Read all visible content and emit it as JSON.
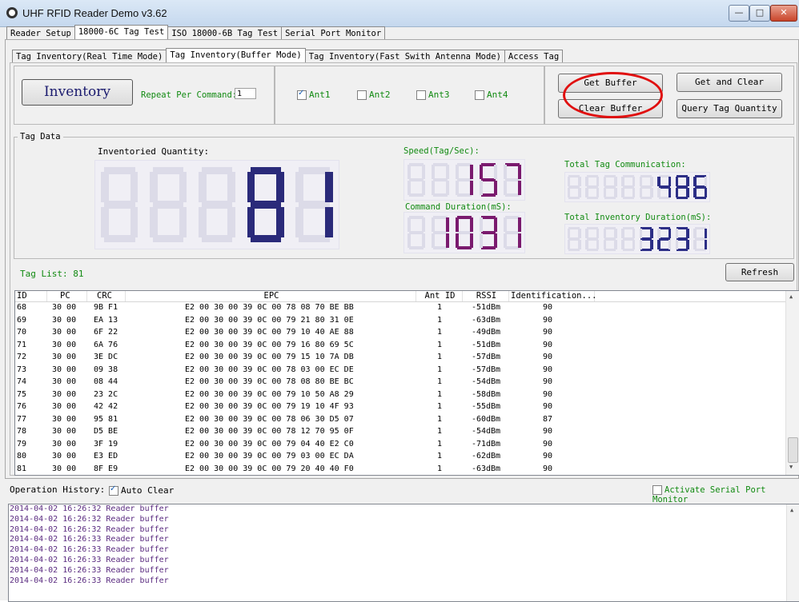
{
  "window": {
    "title": "UHF RFID Reader Demo v3.62",
    "min": "—",
    "max": "□",
    "close": "✕"
  },
  "main_tabs": [
    "Reader Setup",
    "18000-6C Tag Test",
    "ISO 18000-6B Tag Test",
    "Serial Port Monitor"
  ],
  "sub_tabs": [
    "Tag Inventory(Real Time Mode)",
    "Tag Inventory(Buffer Mode)",
    "Tag Inventory(Fast Swith Antenna Mode)",
    "Access Tag"
  ],
  "controls": {
    "inventory_label": "Inventory",
    "repeat_label": "Repeat Per Command:",
    "repeat_value": "1",
    "antennas": [
      {
        "label": "Ant1",
        "checked": true
      },
      {
        "label": "Ant2",
        "checked": false
      },
      {
        "label": "Ant3",
        "checked": false
      },
      {
        "label": "Ant4",
        "checked": false
      }
    ],
    "get_buffer": "Get Buffer",
    "get_and_clear": "Get and Clear",
    "clear_buffer": "Clear Buffer",
    "query_tag_quantity": "Query Tag Quantity"
  },
  "tag_data": {
    "group_label": "Tag Data",
    "inventoried_quantity_label": "Inventoried Quantity:",
    "inventoried_quantity": "81",
    "speed_label": "Speed(Tag/Sec):",
    "speed": "157",
    "command_duration_label": "Command Duration(mS):",
    "command_duration": "1031",
    "total_comm_label": "Total Tag Communication:",
    "total_comm": "486",
    "total_inv_duration_label": "Total Inventory Duration(mS):",
    "total_inv_duration": "3231",
    "lcd_color_main": "#2a2a7a",
    "lcd_color_speed": "#7a1a6e",
    "lcd_color_total": "#2c2e86"
  },
  "tag_list": {
    "label": "Tag List: 81",
    "refresh": "Refresh",
    "columns": [
      "ID",
      "PC",
      "CRC",
      "EPC",
      "Ant ID",
      "RSSI",
      "Identification..."
    ],
    "rows": [
      [
        "68",
        "30 00",
        "9B F1",
        "E2 00 30 00 39 0C 00 78 08 70 BE BB",
        "1",
        "-51dBm",
        "90"
      ],
      [
        "69",
        "30 00",
        "EA 13",
        "E2 00 30 00 39 0C 00 79 21 80 31 0E",
        "1",
        "-63dBm",
        "90"
      ],
      [
        "70",
        "30 00",
        "6F 22",
        "E2 00 30 00 39 0C 00 79 10 40 AE 88",
        "1",
        "-49dBm",
        "90"
      ],
      [
        "71",
        "30 00",
        "6A 76",
        "E2 00 30 00 39 0C 00 79 16 80 69 5C",
        "1",
        "-51dBm",
        "90"
      ],
      [
        "72",
        "30 00",
        "3E DC",
        "E2 00 30 00 39 0C 00 79 15 10 7A DB",
        "1",
        "-57dBm",
        "90"
      ],
      [
        "73",
        "30 00",
        "09 38",
        "E2 00 30 00 39 0C 00 78 03 00 EC DE",
        "1",
        "-57dBm",
        "90"
      ],
      [
        "74",
        "30 00",
        "08 44",
        "E2 00 30 00 39 0C 00 78 08 80 BE BC",
        "1",
        "-54dBm",
        "90"
      ],
      [
        "75",
        "30 00",
        "23 2C",
        "E2 00 30 00 39 0C 00 79 10 50 A8 29",
        "1",
        "-58dBm",
        "90"
      ],
      [
        "76",
        "30 00",
        "42 42",
        "E2 00 30 00 39 0C 00 79 19 10 4F 93",
        "1",
        "-55dBm",
        "90"
      ],
      [
        "77",
        "30 00",
        "95 81",
        "E2 00 30 00 39 0C 00 78 06 30 D5 07",
        "1",
        "-60dBm",
        "87"
      ],
      [
        "78",
        "30 00",
        "D5 BE",
        "E2 00 30 00 39 0C 00 78 12 70 95 0F",
        "1",
        "-54dBm",
        "90"
      ],
      [
        "79",
        "30 00",
        "3F 19",
        "E2 00 30 00 39 0C 00 79 04 40 E2 C0",
        "1",
        "-71dBm",
        "90"
      ],
      [
        "80",
        "30 00",
        "E3 ED",
        "E2 00 30 00 39 0C 00 79 03 00 EC DA",
        "1",
        "-62dBm",
        "90"
      ],
      [
        "81",
        "30 00",
        "8F E9",
        "E2 00 30 00 39 0C 00 79 20 40 40 F0",
        "1",
        "-63dBm",
        "90"
      ]
    ]
  },
  "history": {
    "label": "Operation History:",
    "auto_clear": "Auto Clear",
    "activate_monitor": "Activate Serial Port Monitor",
    "lines": [
      "2014-04-02 16:26:32 Reader buffer",
      "2014-04-02 16:26:32 Reader buffer",
      "2014-04-02 16:26:32 Reader buffer",
      "2014-04-02 16:26:33 Reader buffer",
      "2014-04-02 16:26:33 Reader buffer",
      "2014-04-02 16:26:33 Reader buffer",
      "2014-04-02 16:26:33 Reader buffer",
      "2014-04-02 16:26:33 Reader buffer"
    ]
  }
}
